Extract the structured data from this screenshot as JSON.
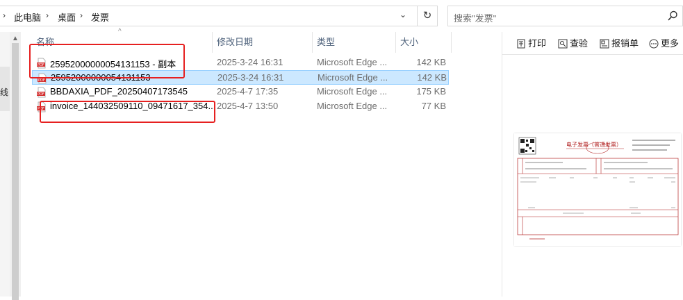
{
  "address": {
    "crumbs": [
      "此电脑",
      "桌面",
      "发票"
    ]
  },
  "search": {
    "placeholder": "搜索\"发票\""
  },
  "nav": {
    "partial_label": "线"
  },
  "columns": {
    "name": "名称",
    "date": "修改日期",
    "type": "类型",
    "size": "大小"
  },
  "files": [
    {
      "name": "25952000000054131153 - 副本",
      "date": "2025-3-24 16:31",
      "type": "Microsoft Edge ...",
      "size": "142 KB",
      "selected": false
    },
    {
      "name": "25952000000054131153",
      "date": "2025-3-24 16:31",
      "type": "Microsoft Edge ...",
      "size": "142 KB",
      "selected": true
    },
    {
      "name": "BBDAXIA_PDF_20250407173545",
      "date": "2025-4-7 17:35",
      "type": "Microsoft Edge ...",
      "size": "175 KB",
      "selected": false
    },
    {
      "name": "invoice_144032509110_09471617_354...",
      "date": "2025-4-7 13:50",
      "type": "Microsoft Edge ...",
      "size": "77 KB",
      "selected": false
    }
  ],
  "preview_toolbar": {
    "print": "打印",
    "verify": "查验",
    "reimburse": "报销单",
    "more": "更多"
  },
  "invoice_preview": {
    "title": "电子发票（普通发票）"
  },
  "colors": {
    "selected_row": "#cce8ff",
    "annotation_red": "#e62020",
    "pdf_red": "#d32f2f"
  }
}
